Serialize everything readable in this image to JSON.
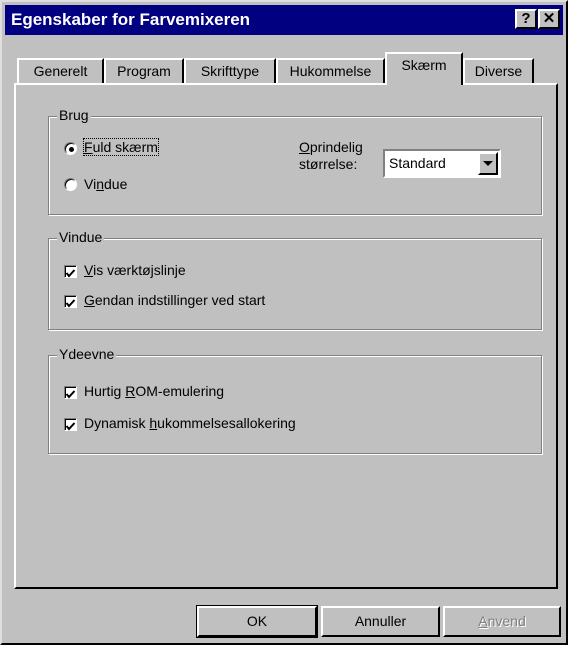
{
  "window": {
    "title": "Egenskaber for Farvemixeren",
    "help_button": "?",
    "close_button": "✕"
  },
  "tabs": [
    {
      "label": "Generelt"
    },
    {
      "label": "Program"
    },
    {
      "label": "Skrifttype"
    },
    {
      "label": "Hukommelse"
    },
    {
      "label": "Skærm",
      "active": true
    },
    {
      "label": "Diverse"
    }
  ],
  "brug": {
    "title": "Brug",
    "options": [
      {
        "pre": "",
        "mnemonic": "F",
        "post": "uld skærm",
        "selected": true
      },
      {
        "pre": "Vi",
        "mnemonic": "n",
        "post": "due",
        "selected": false
      }
    ],
    "size_label_line1_mnemonic": "O",
    "size_label_line1_rest": "prindelig",
    "size_label_line2": "størrelse:",
    "size_value": "Standard"
  },
  "vindue": {
    "title": "Vindue",
    "items": [
      {
        "pre": "",
        "mnemonic": "V",
        "post": "is værktøjslinje",
        "checked": true
      },
      {
        "pre": "",
        "mnemonic": "G",
        "post": "endan indstillinger ved start",
        "checked": true
      }
    ]
  },
  "ydeevne": {
    "title": "Ydeevne",
    "items": [
      {
        "pre": "Hurtig ",
        "mnemonic": "R",
        "post": "OM-emulering",
        "checked": true
      },
      {
        "pre": "Dynamisk ",
        "mnemonic": "h",
        "post": "ukommelsesallokering",
        "checked": true
      }
    ]
  },
  "buttons": {
    "ok": "OK",
    "cancel": "Annuller",
    "apply_mnemonic": "A",
    "apply_rest": "nvend"
  }
}
